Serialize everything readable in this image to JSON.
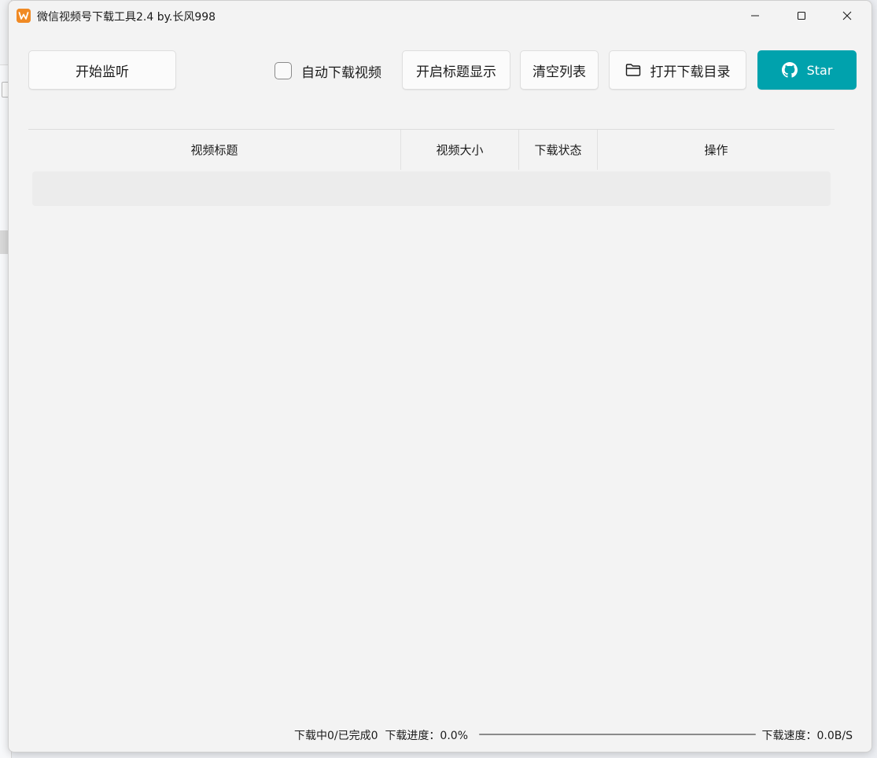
{
  "window": {
    "title": "微信视频号下载工具2.4 by.长风998"
  },
  "toolbar": {
    "start_label": "开始监听",
    "auto_download_label": "自动下载视频",
    "auto_download_checked": false,
    "title_display_label": "开启标题显示",
    "clear_label": "清空列表",
    "open_dir_label": "打开下载目录",
    "star_label": "Star"
  },
  "table": {
    "columns": [
      "视频标题",
      "视频大小",
      "下载状态",
      "操作"
    ],
    "rows": []
  },
  "status": {
    "counts": "下载中0/已完成0",
    "progress_label": "下载进度：0.0%",
    "progress_fraction": 0.0,
    "speed_label": "下载速度：0.0B/S"
  },
  "colors": {
    "accent": "#00a2ad",
    "app_icon": "#f08a24",
    "window_bg": "#f3f3f3"
  },
  "icons": {
    "app": "app-logo-icon",
    "folder": "folder-icon",
    "github": "github-icon",
    "minimize": "minimize-icon",
    "maximize": "maximize-icon",
    "close": "close-icon"
  }
}
